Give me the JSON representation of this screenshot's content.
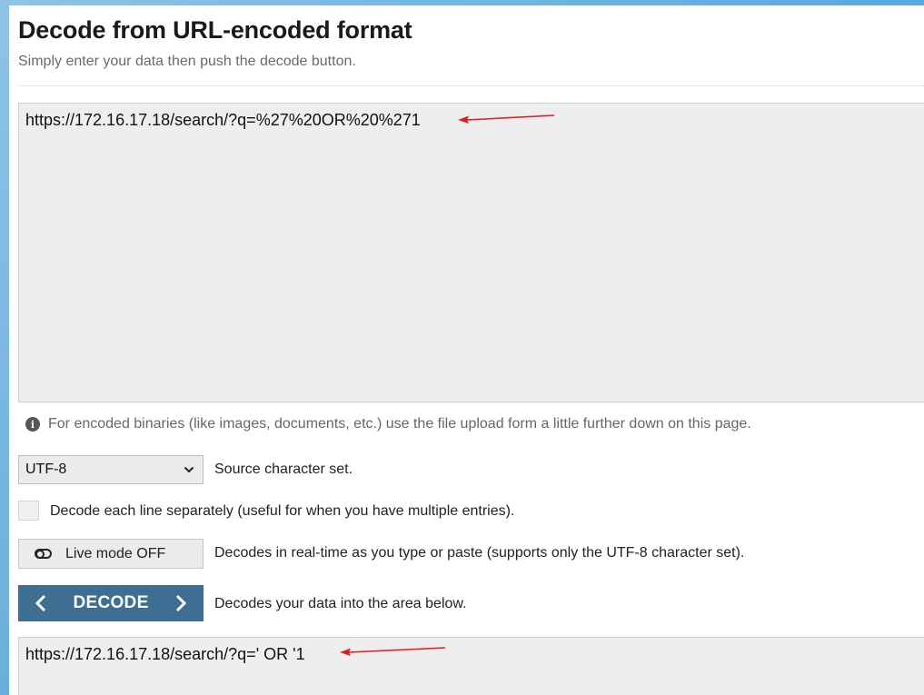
{
  "page": {
    "title": "Decode from URL-encoded format",
    "subtitle": "Simply enter your data then push the decode button."
  },
  "input": {
    "value": "https://172.16.17.18/search/?q=%27%20OR%20%271"
  },
  "info": {
    "icon": "info-icon",
    "text": "For encoded binaries (like images, documents, etc.) use the file upload form a little further down on this page."
  },
  "charset": {
    "selected": "UTF-8",
    "label": "Source character set."
  },
  "line_option": {
    "checked": false,
    "label": "Decode each line separately (useful for when you have multiple entries)."
  },
  "live_mode": {
    "button_label": "Live mode OFF",
    "description": "Decodes in real-time as you type or paste (supports only the UTF-8 character set)."
  },
  "decode": {
    "button_label": "DECODE",
    "description": "Decodes your data into the area below.",
    "color": "#3d6f94"
  },
  "output": {
    "value": "https://172.16.17.18/search/?q=' OR '1"
  },
  "annotations": {
    "arrow_color": "#e01b1b"
  }
}
